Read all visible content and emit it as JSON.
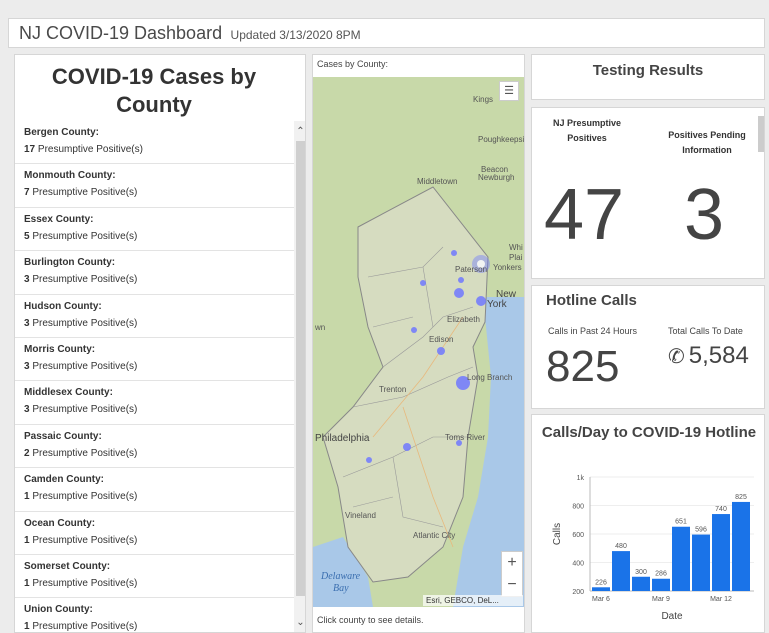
{
  "header": {
    "title": "NJ COVID-19 Dashboard",
    "updated": "Updated 3/13/2020 8PM"
  },
  "cases_panel": {
    "title": "COVID-19 Cases by County",
    "counties": [
      {
        "name": "Bergen County:",
        "count": "17",
        "suffix": "Presumptive Positive(s)"
      },
      {
        "name": "Monmouth County:",
        "count": "7",
        "suffix": "Presumptive Positive(s)"
      },
      {
        "name": "Essex County:",
        "count": "5",
        "suffix": "Presumptive Positive(s)"
      },
      {
        "name": "Burlington County:",
        "count": "3",
        "suffix": "Presumptive Positive(s)"
      },
      {
        "name": "Hudson County:",
        "count": "3",
        "suffix": "Presumptive Positive(s)"
      },
      {
        "name": "Morris County:",
        "count": "3",
        "suffix": "Presumptive Positive(s)"
      },
      {
        "name": "Middlesex County:",
        "count": "3",
        "suffix": "Presumptive Positive(s)"
      },
      {
        "name": "Passaic County:",
        "count": "2",
        "suffix": "Presumptive Positive(s)"
      },
      {
        "name": "Camden County:",
        "count": "1",
        "suffix": "Presumptive Positive(s)"
      },
      {
        "name": "Ocean County:",
        "count": "1",
        "suffix": "Presumptive Positive(s)"
      },
      {
        "name": "Somerset County:",
        "count": "1",
        "suffix": "Presumptive Positive(s)"
      },
      {
        "name": "Union County:",
        "count": "1",
        "suffix": "Presumptive Positive(s)"
      }
    ]
  },
  "map": {
    "title": "Cases by County:",
    "footer": "Click county to see details.",
    "attribution": "Esri, GEBCO, DeL...",
    "zoom_in": "+",
    "zoom_out": "−",
    "labels": [
      "Kings",
      "Poughkeepsie",
      "Beacon",
      "Newburgh",
      "Middletown",
      "Whi",
      "Plai",
      "Paterson",
      "Yonkers",
      "New",
      "York",
      "Elizabeth",
      "wn",
      "Edison",
      "Trenton",
      "Long Branch",
      "Philadelphia",
      "Toms River",
      "Vineland",
      "Atlantic City",
      "Delaware",
      "Bay"
    ]
  },
  "testing": {
    "title": "Testing Results",
    "presumptive_label": "NJ Presumptive Positives",
    "presumptive_value": "47",
    "pending_label": "Positives Pending Information",
    "pending_value": "3"
  },
  "hotline": {
    "title": "Hotline Calls",
    "calls_24h_label": "Calls in Past 24 Hours",
    "calls_24h_value": "825",
    "total_label": "Total Calls To Date",
    "total_value": "5,584"
  },
  "chart_data": {
    "type": "bar",
    "title": "Calls/Day to COVID-19 Hotline",
    "xlabel": "Date",
    "ylabel": "Calls",
    "x_ticks": [
      "Mar 6",
      "Mar 9",
      "Mar 12"
    ],
    "y_ticks": [
      "200",
      "400",
      "600",
      "800",
      "1k"
    ],
    "ylim": [
      200,
      1000
    ],
    "values": [
      226,
      480,
      300,
      286,
      651,
      596,
      740,
      825
    ],
    "color": "#1a73e8"
  },
  "colors": {
    "bar": "#1a73e8",
    "map_dot": "#6e78ff"
  }
}
